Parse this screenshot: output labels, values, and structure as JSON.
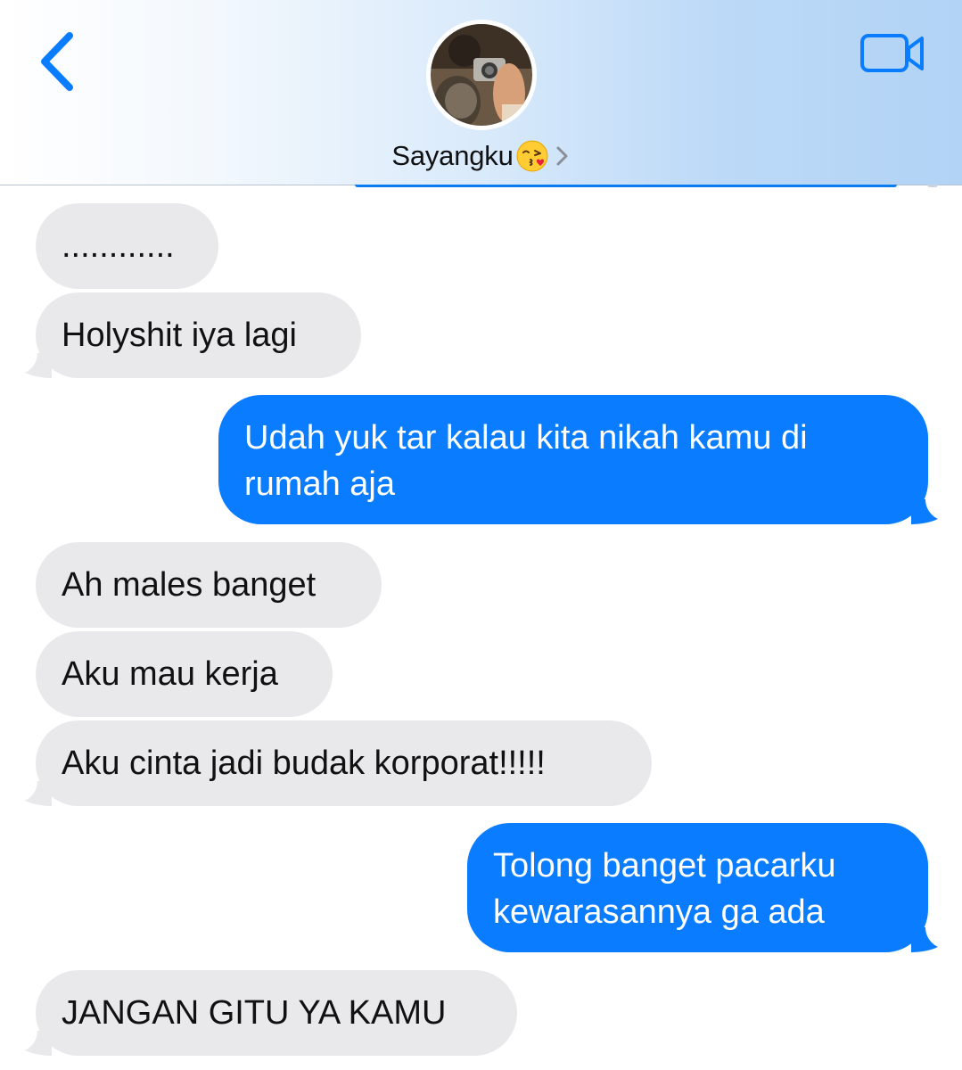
{
  "header": {
    "contact_name": "Sayangku",
    "emoji_icon": "face-blowing-kiss-emoji",
    "back_icon": "chevron-left-icon",
    "video_icon": "video-camera-icon",
    "accent_color": "#0a7cff"
  },
  "messages": [
    {
      "direction": "received",
      "text": "............"
    },
    {
      "direction": "received",
      "text": "Holyshit iya lagi"
    },
    {
      "direction": "sent",
      "text": "Udah yuk tar kalau kita nikah kamu di rumah aja"
    },
    {
      "direction": "received",
      "text": "Ah males banget"
    },
    {
      "direction": "received",
      "text": "Aku mau kerja"
    },
    {
      "direction": "received",
      "text": "Aku cinta jadi budak korporat!!!!!"
    },
    {
      "direction": "sent",
      "text": "Tolong banget pacarku kewarasannya ga ada"
    },
    {
      "direction": "received",
      "text": "JANGAN GITU YA KAMU"
    }
  ],
  "colors": {
    "sent_bubble": "#0a7cff",
    "received_bubble": "#e9e9eb"
  }
}
